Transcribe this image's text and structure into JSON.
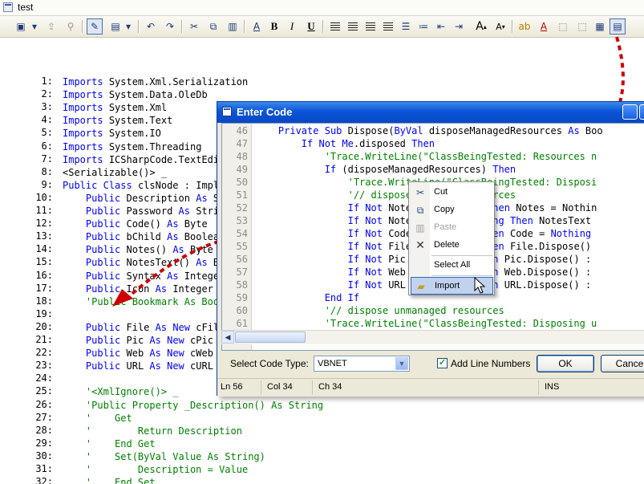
{
  "window": {
    "title": "test"
  },
  "toolbar": {
    "bold_label": "B",
    "italic_label": "I",
    "underline_label": "U",
    "font_size_up": "A",
    "font_size_down": "A"
  },
  "editor": {
    "lines": [
      {
        "n": "1:",
        "text": "Imports System.Xml.Serialization"
      },
      {
        "n": "2:",
        "text": "Imports System.Data.OleDb"
      },
      {
        "n": "3:",
        "text": "Imports System.Xml"
      },
      {
        "n": "4:",
        "text": "Imports System.Text"
      },
      {
        "n": "5:",
        "text": "Imports System.IO"
      },
      {
        "n": "6:",
        "text": "Imports System.Threading"
      },
      {
        "n": "7:",
        "text": "Imports ICSharpCode.TextEdit"
      },
      {
        "n": "8:",
        "text": "<Serializable()> _"
      },
      {
        "n": "9:",
        "text": "Public Class clsNode : Impl"
      },
      {
        "n": "10:",
        "text": "    Public Description As S"
      },
      {
        "n": "11:",
        "text": "    Public Password As Strin"
      },
      {
        "n": "12:",
        "text": "    Public Code() As Byte"
      },
      {
        "n": "13:",
        "text": "    Public bChild As Boolea"
      },
      {
        "n": "14:",
        "text": "    Public Notes() As Byte"
      },
      {
        "n": "15:",
        "text": "    Public NotesText() As By"
      },
      {
        "n": "16:",
        "text": "    Public Syntax As Integer"
      },
      {
        "n": "17:",
        "text": "    Public Icon As Integer"
      },
      {
        "n": "18:",
        "text": "    'Public Bookmark As Boo"
      },
      {
        "n": "19:",
        "text": ""
      },
      {
        "n": "20:",
        "text": "    Public File As New cFile"
      },
      {
        "n": "21:",
        "text": "    Public Pic As New cPic"
      },
      {
        "n": "22:",
        "text": "    Public Web As New cWeb"
      },
      {
        "n": "23:",
        "text": "    Public URL As New cURL"
      },
      {
        "n": "24:",
        "text": ""
      },
      {
        "n": "25:",
        "text": "    '<XmlIgnore()> _"
      },
      {
        "n": "26:",
        "text": "    'Public Property _Description() As String"
      },
      {
        "n": "27:",
        "text": "    '    Get"
      },
      {
        "n": "28:",
        "text": "    '        Return Description"
      },
      {
        "n": "29:",
        "text": "    '    End Get"
      },
      {
        "n": "30:",
        "text": "    '    Set(ByVal Value As String)"
      },
      {
        "n": "31:",
        "text": "    '        Description = Value"
      },
      {
        "n": "32:",
        "text": "    '    End Set"
      }
    ]
  },
  "dialog": {
    "title": "Enter Code",
    "code_lines": [
      {
        "n": "46",
        "text": "    Private Sub Dispose(ByVal disposeManagedResources As Boo"
      },
      {
        "n": "47",
        "text": "        If Not Me.disposed Then"
      },
      {
        "n": "48",
        "text": "            'Trace.WriteLine(\"ClassBeingTested: Resources n"
      },
      {
        "n": "49",
        "text": "            If (disposeManagedResources) Then"
      },
      {
        "n": "50",
        "text": "                'Trace.WriteLine(\"ClassBeingTested: Disposi"
      },
      {
        "n": "51",
        "text": "                '// dispose managed resources"
      },
      {
        "n": "52",
        "text": "                If Not Notes Is Nothing Then Notes = Nothin"
      },
      {
        "n": "53",
        "text": "                If Not NotesText Is Nothing Then NotesText "
      },
      {
        "n": "54",
        "text": "                If Not Code Is Nothing Then Code = Nothing"
      },
      {
        "n": "55",
        "text": "                If Not File Is Nothing Then File.Dispose()"
      },
      {
        "n": "56",
        "text": "                If Not Pic Is Nothing Then Pic.Dispose() :"
      },
      {
        "n": "57",
        "text": "                If Not Web Is Nothing Then Web.Dispose() :"
      },
      {
        "n": "58",
        "text": "                If Not URL Is Nothing Then URL.Dispose() :"
      },
      {
        "n": "59",
        "text": "            End If"
      },
      {
        "n": "60",
        "text": "            '// dispose unmanaged resources"
      },
      {
        "n": "61",
        "text": "            'Trace.WriteLine(\"ClassBeingTested: Disposing u"
      }
    ],
    "select_label": "Select Code Type:",
    "code_type": "VBNET",
    "add_line_numbers_label": "Add Line Numbers",
    "add_line_numbers_checked": true,
    "ok_label": "OK",
    "cancel_label": "Cance",
    "status": {
      "ln": "Ln 56",
      "col": "Col 34",
      "ch": "Ch 34",
      "mode": "INS"
    }
  },
  "context_menu": {
    "items": [
      {
        "label": "Cut",
        "icon": "scissors-icon",
        "disabled": false
      },
      {
        "label": "Copy",
        "icon": "copy-icon",
        "disabled": false
      },
      {
        "label": "Paste",
        "icon": "paste-icon",
        "disabled": true
      },
      {
        "label": "Delete",
        "icon": "delete-x-icon",
        "disabled": false
      },
      {
        "label": "Select All",
        "icon": "",
        "disabled": false
      },
      {
        "label": "Import",
        "icon": "folder-open-icon",
        "disabled": false,
        "highlighted": true
      }
    ]
  },
  "colors": {
    "keyword": "#0000ff",
    "comment": "#008000",
    "arrow": "#cc0000",
    "titlebar": "#0a55d8"
  }
}
